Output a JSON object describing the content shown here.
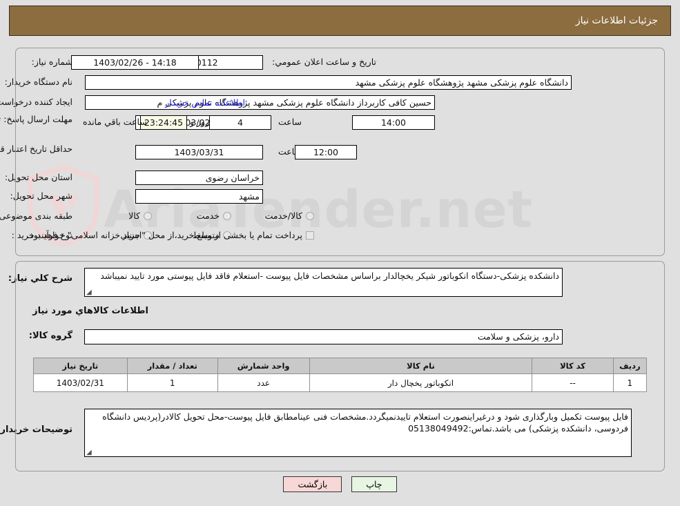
{
  "header": {
    "title": "جزئیات اطلاعات نیاز"
  },
  "watermark": {
    "text": "AriaTender.net",
    "icon": "shield-icon"
  },
  "details": {
    "need_number_label": "شماره نیاز:",
    "need_number_value": "1103000060000112",
    "public_announce_label": "تاریخ و ساعت اعلان عمومي:",
    "public_announce_value": "1403/02/26 - 14:18",
    "buyer_org_label": "نام دستگاه خریدار:",
    "buyer_org_value": "دانشگاه علوم پزشکی مشهد   پژوهشگاه علوم پزشکی مشهد",
    "creator_label": "ایجاد کننده درخواست:",
    "creator_value": "حسین کافی کاربرداز دانشگاه علوم پزشکی مشهد   پژوهشگاه علوم پزشکی م",
    "buyer_contact_link": "اطلاعات تماس خریدار",
    "response_deadline_label": "مهلت ارسال پاسخ: تا تاریخ:",
    "response_deadline_date": "1403/02/31",
    "hour_label": "ساعت",
    "response_deadline_time": "14:00",
    "remaining_days": "4",
    "remaining_days_unit": "روز و",
    "remaining_countdown": "23:24:45",
    "remaining_suffix": "ساعت باقي مانده",
    "price_validity_label": "حداقل تاریخ اعتبار قیمت: تا تاریخ:",
    "price_validity_date": "1403/03/31",
    "price_validity_time": "12:00",
    "province_label": "استان محل تحویل:",
    "province_value": "خراسان رضوی",
    "city_label": "شهر محل تحویل:",
    "city_value": "مشهد",
    "classification_label": "طبقه بندی موضوعی:",
    "classification_options": [
      "کالا",
      "خدمت",
      "کالا/خدمت"
    ],
    "process_type_label": "نوع فرآیند خرید :",
    "process_type_options": [
      "جزیي",
      "متوسط"
    ],
    "treasury_checkbox_label": "پرداخت تمام یا بخشی از مبلغ خرید،از محل \"اسناد خزانه اسلامی\" خواهد بود."
  },
  "summary": {
    "label": "شرح کلي نیاز:",
    "value": "دانشکده پزشکی-دستگاه انکوباتور شیکر یخچالدار براساس مشخصات فایل پیوست -استعلام فاقد فایل پیوستی مورد تایید نمیباشد"
  },
  "goods_section": {
    "heading": "اطلاعات کالاهاي مورد نیاز",
    "group_label": "گروه کالا:",
    "group_value": "دارو، پزشکی و سلامت"
  },
  "table": {
    "headers": [
      "ردیف",
      "کد کالا",
      "نام کالا",
      "واحد شمارش",
      "تعداد / مقدار",
      "تاریخ نیاز"
    ],
    "rows": [
      [
        "1",
        "--",
        "انکوباتور یخچال دار",
        "عدد",
        "1",
        "1403/02/31"
      ]
    ]
  },
  "buyer_notes": {
    "label": "توضیحات خریدار:",
    "value": "فایل پیوست تکمیل وبارگذاری شود و درغیراینصورت استعلام تاییدنمیگردد.مشخصات فنی عینامطابق فایل پیوست-محل تحویل کالادر(پردیس دانشگاه فردوسی، دانشکده پزشکی) می باشد.تماس:05138049492"
  },
  "buttons": {
    "print": "چاپ",
    "back": "بازگشت"
  },
  "colors": {
    "header_brown": "#8c6d40",
    "page_bg": "#e0e0e0",
    "link_blue": "#2222ee",
    "countdown_bg": "#fbfbe8",
    "table_header_bg": "#c9c9c9",
    "print_btn_bg": "#e8f5e2",
    "back_btn_bg": "#f8d7d7"
  }
}
